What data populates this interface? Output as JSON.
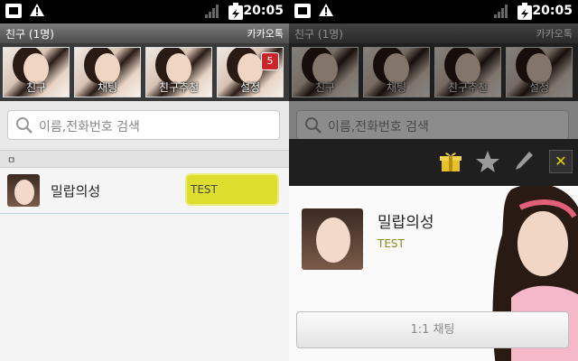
{
  "status_bar": {
    "time": "20:05"
  },
  "header": {
    "title": "친구 (1명)",
    "brand": "카카오톡"
  },
  "tabs": [
    {
      "label": "친구"
    },
    {
      "label": "채팅"
    },
    {
      "label": "친구추천"
    },
    {
      "label": "설정",
      "badge": "5"
    }
  ],
  "search": {
    "placeholder": "이름,전화번호 검색"
  },
  "section": {
    "index_letter": "ㅁ"
  },
  "friend": {
    "name": "밀랍의성",
    "status_message": "TEST"
  },
  "profile_popup": {
    "name": "밀랍의성",
    "status_message": "TEST",
    "chat_button": "1:1 채팅",
    "actions": [
      "gift-icon",
      "star-icon",
      "edit-icon",
      "close-icon"
    ]
  },
  "colors": {
    "status_highlight": "#dede2e",
    "badge": "#c8262b",
    "close_accent": "#e6d000"
  }
}
